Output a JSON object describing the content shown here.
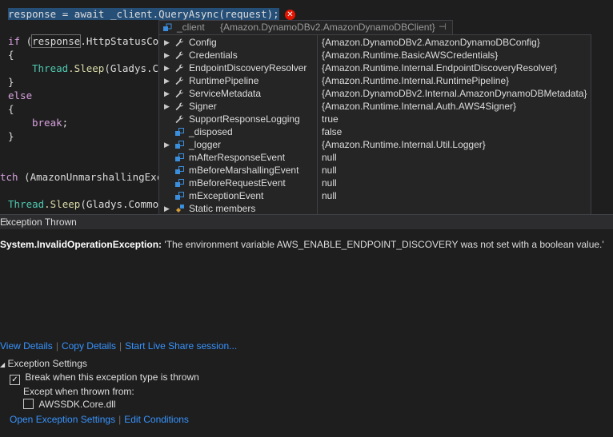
{
  "code": {
    "line1": {
      "var": "response",
      "rest": " = await _client.QueryAsync(request);"
    },
    "line2": {
      "kw": "if",
      "open": " (",
      "var": "response",
      "rest": ".HttpStatusCod"
    },
    "line3": "{",
    "line4": {
      "type": "Thread",
      "method": ".Sleep",
      "rest": "(Gladys.Co"
    },
    "line5": "}",
    "line6": "else",
    "line7": "{",
    "line8": {
      "kw": "break",
      "rest": ";"
    },
    "line9": "}",
    "line10": {
      "kw": "tch",
      "rest": " (AmazonUnmarshallingExce"
    },
    "line11": {
      "type": "Thread",
      "method": ".Sleep",
      "rest": "(Gladys.Common"
    }
  },
  "datatip": {
    "header_name": "_client",
    "header_value": "{Amazon.DynamoDBv2.AmazonDynamoDBClient}",
    "header_pin": "⊣",
    "rows": [
      {
        "expand": "▶",
        "icon": "wrench-icon",
        "name": "Config",
        "value": "{Amazon.DynamoDBv2.AmazonDynamoDBConfig}"
      },
      {
        "expand": "▶",
        "icon": "wrench-icon",
        "name": "Credentials",
        "value": "{Amazon.Runtime.BasicAWSCredentials}"
      },
      {
        "expand": "▶",
        "icon": "wrench-icon",
        "name": "EndpointDiscoveryResolver",
        "value": "{Amazon.Runtime.Internal.EndpointDiscoveryResolver}"
      },
      {
        "expand": "▶",
        "icon": "wrench-icon",
        "name": "RuntimePipeline",
        "value": "{Amazon.Runtime.Internal.RuntimePipeline}"
      },
      {
        "expand": "▶",
        "icon": "wrench-icon",
        "name": "ServiceMetadata",
        "value": "{Amazon.DynamoDBv2.Internal.AmazonDynamoDBMetadata}"
      },
      {
        "expand": "▶",
        "icon": "wrench-icon",
        "name": "Signer",
        "value": "{Amazon.Runtime.Internal.Auth.AWS4Signer}"
      },
      {
        "expand": "",
        "icon": "wrench-icon",
        "name": "SupportResponseLogging",
        "value": "true"
      },
      {
        "expand": "",
        "icon": "field-icon",
        "name": "_disposed",
        "value": "false"
      },
      {
        "expand": "▶",
        "icon": "field-icon",
        "name": "_logger",
        "value": "{Amazon.Runtime.Internal.Util.Logger}"
      },
      {
        "expand": "",
        "icon": "field-icon",
        "name": "mAfterResponseEvent",
        "value": "null"
      },
      {
        "expand": "",
        "icon": "field-icon",
        "name": "mBeforeMarshallingEvent",
        "value": "null"
      },
      {
        "expand": "",
        "icon": "field-icon",
        "name": "mBeforeRequestEvent",
        "value": "null"
      },
      {
        "expand": "",
        "icon": "field-icon",
        "name": "mExceptionEvent",
        "value": "null"
      },
      {
        "expand": "▶",
        "icon": "static-members-icon",
        "name": "Static members",
        "value": ""
      }
    ]
  },
  "exception": {
    "title": "Exception Thrown",
    "pin": "⊣",
    "type": "System.InvalidOperationException:",
    "message": " 'The environment variable AWS_ENABLE_ENDPOINT_DISCOVERY was not set with a boolean value.'",
    "links": [
      "View Details",
      "Copy Details",
      "Start Live Share session..."
    ],
    "settings_label": "Exception Settings",
    "settings_arrow": "◢",
    "break_label": "Break when this exception type is thrown",
    "break_checked": "✓",
    "except_label": "Except when thrown from:",
    "dll_label": "AWSSDK.Core.dll",
    "bottom_links": [
      "Open Exception Settings",
      "Edit Conditions"
    ]
  },
  "colors": {
    "accent": "#3794ff",
    "error": "#e51400",
    "selection": "#264f78"
  }
}
